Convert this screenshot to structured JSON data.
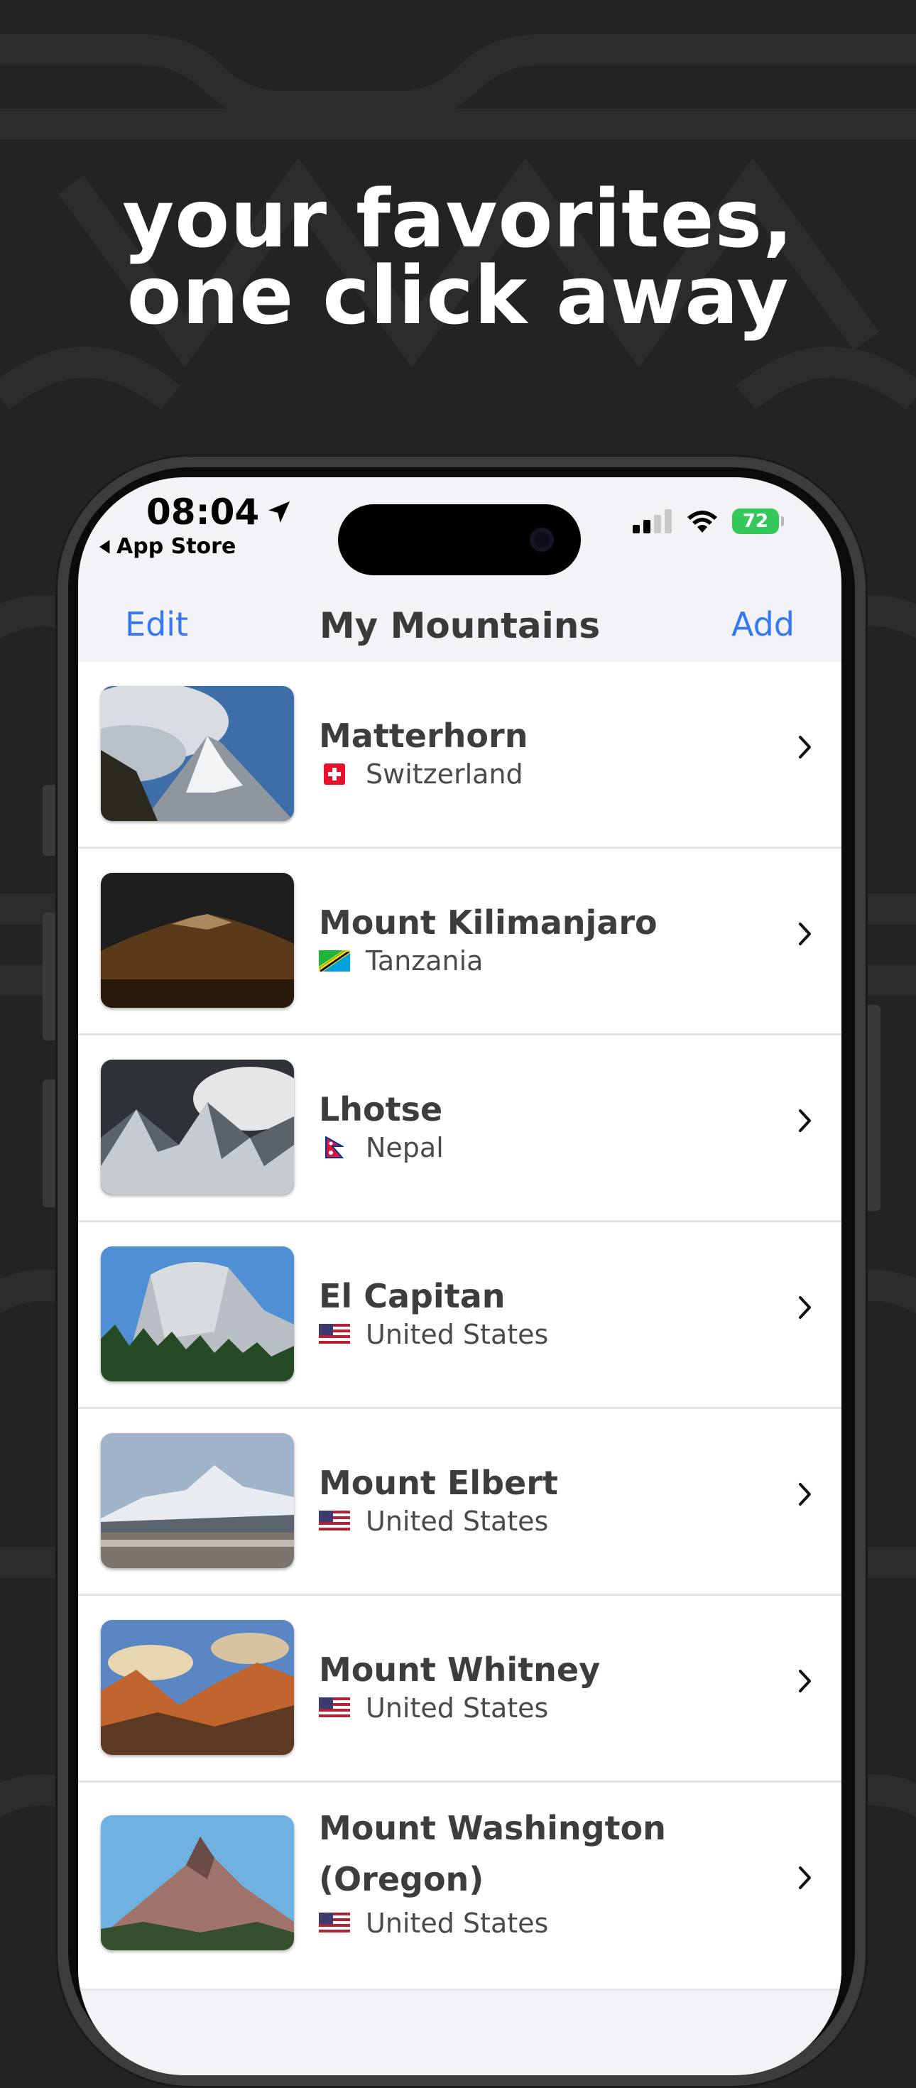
{
  "headline": {
    "line1": "your favorites,",
    "line2": "one click away"
  },
  "status_bar": {
    "time": "08:04",
    "back_app": "App Store",
    "battery": "72"
  },
  "nav": {
    "edit": "Edit",
    "title": "My Mountains",
    "add": "Add"
  },
  "mountains": [
    {
      "name": "Matterhorn",
      "country": "Switzerland",
      "flag": "switzerland-flag-icon"
    },
    {
      "name": "Mount Kilimanjaro",
      "country": "Tanzania",
      "flag": "tanzania-flag-icon"
    },
    {
      "name": "Lhotse",
      "country": "Nepal",
      "flag": "nepal-flag-icon"
    },
    {
      "name": "El Capitan",
      "country": "United States",
      "flag": "us-flag-icon"
    },
    {
      "name": "Mount Elbert",
      "country": "United States",
      "flag": "us-flag-icon"
    },
    {
      "name": "Mount Whitney",
      "country": "United States",
      "flag": "us-flag-icon"
    },
    {
      "name": "Mount Washington\n(Oregon)",
      "country": "United States",
      "flag": "us-flag-icon"
    }
  ],
  "colors": {
    "accent": "#3478f6",
    "battery": "#34c759",
    "background": "#232323"
  }
}
